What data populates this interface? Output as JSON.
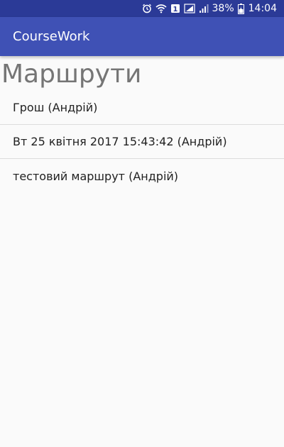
{
  "status_bar": {
    "battery": "38%",
    "time": "14:04",
    "sim_badge": "1",
    "icons": [
      "alarm-icon",
      "wifi-icon",
      "sim-signal-icon",
      "cell-signal-icon",
      "battery-icon"
    ]
  },
  "app_bar": {
    "title": "CourseWork",
    "color": "#3f51b5",
    "status_color": "#2b3a97"
  },
  "page": {
    "heading": "Маршрути"
  },
  "routes": [
    {
      "label": "Грош (Андрій)"
    },
    {
      "label": "Вт 25 квітня 2017 15:43:42 (Андрій)"
    },
    {
      "label": "тестовий маршрут (Андрій)"
    }
  ]
}
